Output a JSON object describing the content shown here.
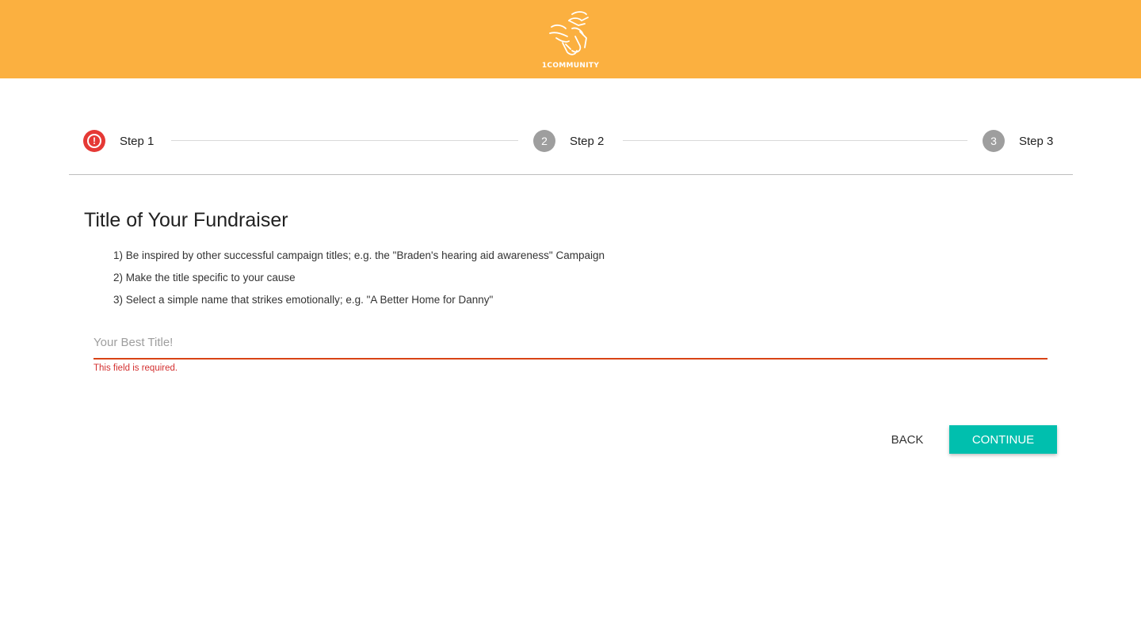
{
  "header": {
    "brand_color": "#fbb040",
    "logo_text": "1COMMUNITY"
  },
  "stepper": {
    "steps": [
      {
        "label": "Step 1",
        "indicator": "!",
        "state": "error",
        "icon": "error-icon"
      },
      {
        "label": "Step 2",
        "indicator": "2",
        "state": "inactive"
      },
      {
        "label": "Step 3",
        "indicator": "3",
        "state": "inactive"
      }
    ],
    "error_color": "#e53935",
    "inactive_color": "#9e9e9e"
  },
  "form": {
    "title": "Title of Your Fundraiser",
    "tips": [
      "1) Be inspired by other successful campaign titles; e.g. the \"Braden's hearing aid awareness\" Campaign",
      "2) Make the title specific to your cause",
      "3) Select a simple name that strikes emotionally; e.g. \"A Better Home for Danny\""
    ],
    "title_field": {
      "placeholder": "Your Best Title!",
      "value": "",
      "error": "This field is required."
    }
  },
  "actions": {
    "back_label": "BACK",
    "continue_label": "CONTINUE",
    "accent_color": "#00bfae"
  }
}
